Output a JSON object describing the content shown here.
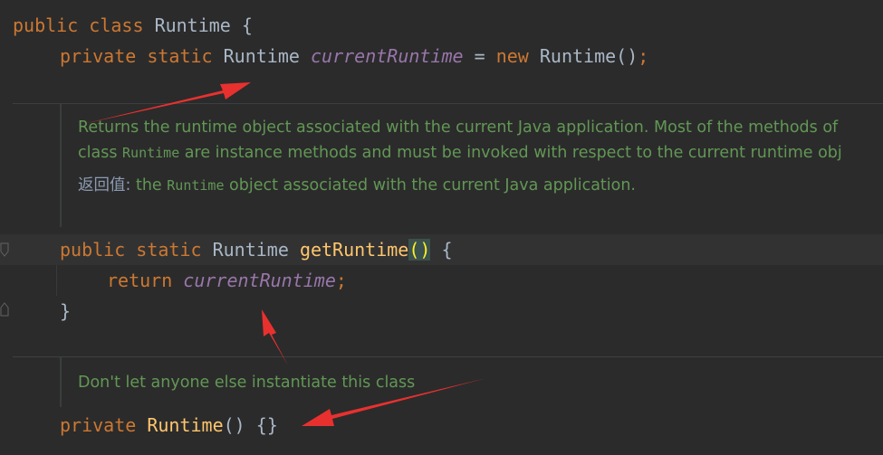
{
  "editor": {
    "line1": {
      "kw1": "public",
      "kw2": "class",
      "name": "Runtime",
      "brace": "{"
    },
    "line2": {
      "kw1": "private",
      "kw2": "static",
      "type": "Runtime",
      "field": "currentRuntime",
      "eq": "=",
      "kw3": "new",
      "ctor": "Runtime",
      "parens": "()",
      "semi": ";"
    },
    "doc1": {
      "line1": "Returns the runtime object associated with the current Java application. Most of the methods of",
      "line2_pre": "class ",
      "line2_code": "Runtime",
      "line2_post": " are instance methods and must be invoked with respect to the current runtime obj",
      "return_tag": "返回值:",
      "return_pre": " the ",
      "return_code": "Runtime",
      "return_post": " object associated with the current Java application."
    },
    "line3": {
      "kw1": "public",
      "kw2": "static",
      "type": "Runtime",
      "method": "getRuntime",
      "parens": "()",
      "brace": "{"
    },
    "line4": {
      "kw": "return",
      "field": "currentRuntime",
      "semi": ";"
    },
    "line5": {
      "brace": "}"
    },
    "doc2": {
      "text": "Don't let anyone else instantiate this class"
    },
    "line6": {
      "kw": "private",
      "ctor": "Runtime",
      "parens": "()",
      "body": "{}"
    }
  },
  "colors": {
    "background": "#2b2b2b",
    "keyword": "#cc7832",
    "field": "#9876aa",
    "method": "#ffc66d",
    "doc": "#629755",
    "arrow": "#e8312f"
  }
}
